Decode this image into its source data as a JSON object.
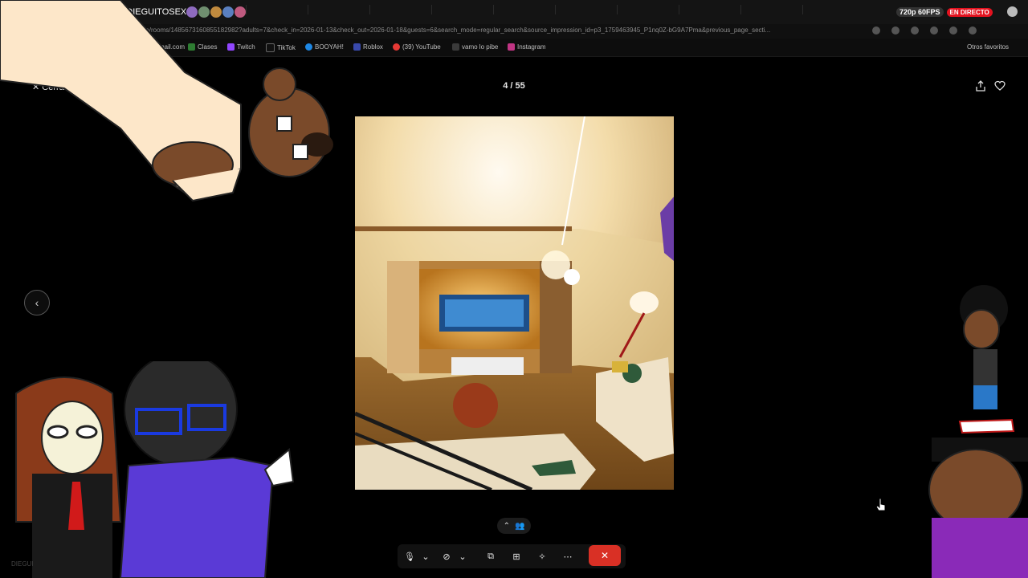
{
  "browser": {
    "tab_title": "de DIEGUITOSEXO",
    "url": "m.pe/rooms/1485673160855182982?adults=7&check_in=2026-01-13&check_out=2026-01-18&guests=6&search_mode=regular_search&source_impression_id=p3_1759463945_P1nq0Z-bG9A7Pma&previous_page_secti...",
    "stream_quality": "720p 60FPS",
    "live_badge": "EN DIRECTO",
    "bookmarks": [
      {
        "label": "mail.com",
        "color": "#4a4a4a"
      },
      {
        "label": "Clases",
        "color": "#2e7d32"
      },
      {
        "label": "Twitch",
        "color": "#9146ff"
      },
      {
        "label": "TikTok",
        "color": "#111111"
      },
      {
        "label": "BOOYAH!",
        "color": "#1e88e5"
      },
      {
        "label": "Roblox",
        "color": "#3949ab"
      },
      {
        "label": "(39) YouTube",
        "color": "#e53935"
      },
      {
        "label": "vamo lo pibe",
        "color": "#3a3a3a"
      },
      {
        "label": "Instagram",
        "color": "#c13584"
      }
    ],
    "other_bookmarks": "Otros favoritos"
  },
  "gallery": {
    "counter": "4 / 55",
    "close_label": "Cerrar"
  },
  "meet": {
    "bottom_left_label": "DIEGUI"
  },
  "colors": {
    "end_call": "#d93025",
    "live": "#e3121f"
  }
}
